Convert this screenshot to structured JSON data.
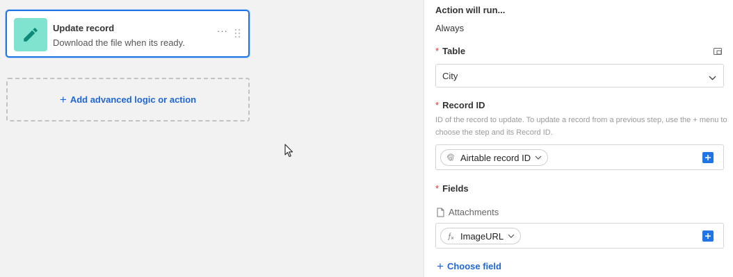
{
  "canvas": {
    "action_card": {
      "title": "Update record",
      "description": "Download the file when its ready.",
      "more": "···"
    },
    "add_logic": {
      "plus": "+",
      "label": "Add advanced logic or action"
    }
  },
  "panel": {
    "run_heading": "Action will run...",
    "run_value": "Always",
    "table": {
      "required_mark": "*",
      "label": "Table",
      "value": "City"
    },
    "record_id": {
      "required_mark": "*",
      "label": "Record ID",
      "help": "ID of the record to update. To update a record from a previous step, use the + menu to choose the step and its Record ID.",
      "token": "Airtable record ID"
    },
    "fields": {
      "required_mark": "*",
      "label": "Fields",
      "attachment_label": "Attachments",
      "token": "ImageURL"
    },
    "choose_field": {
      "plus": "+",
      "label": "Choose field"
    }
  },
  "colors": {
    "accent": "#1f74e6",
    "link": "#1f66d4",
    "required": "#d43333",
    "icon_tile": "#7fe3d0",
    "icon_pencil": "#0f8a78"
  },
  "icons": {
    "action_icon": "pencil-icon",
    "more": "ellipsis-icon",
    "drag": "drag-handle-icon",
    "table_expand": "expand-panel-icon",
    "select_chevron": "chevron-down-icon",
    "record_token_icon": "fingerprint-icon",
    "fields_token_icon": "formula-icon",
    "attachment_icon": "file-icon",
    "add_token": "plus-square-icon"
  }
}
